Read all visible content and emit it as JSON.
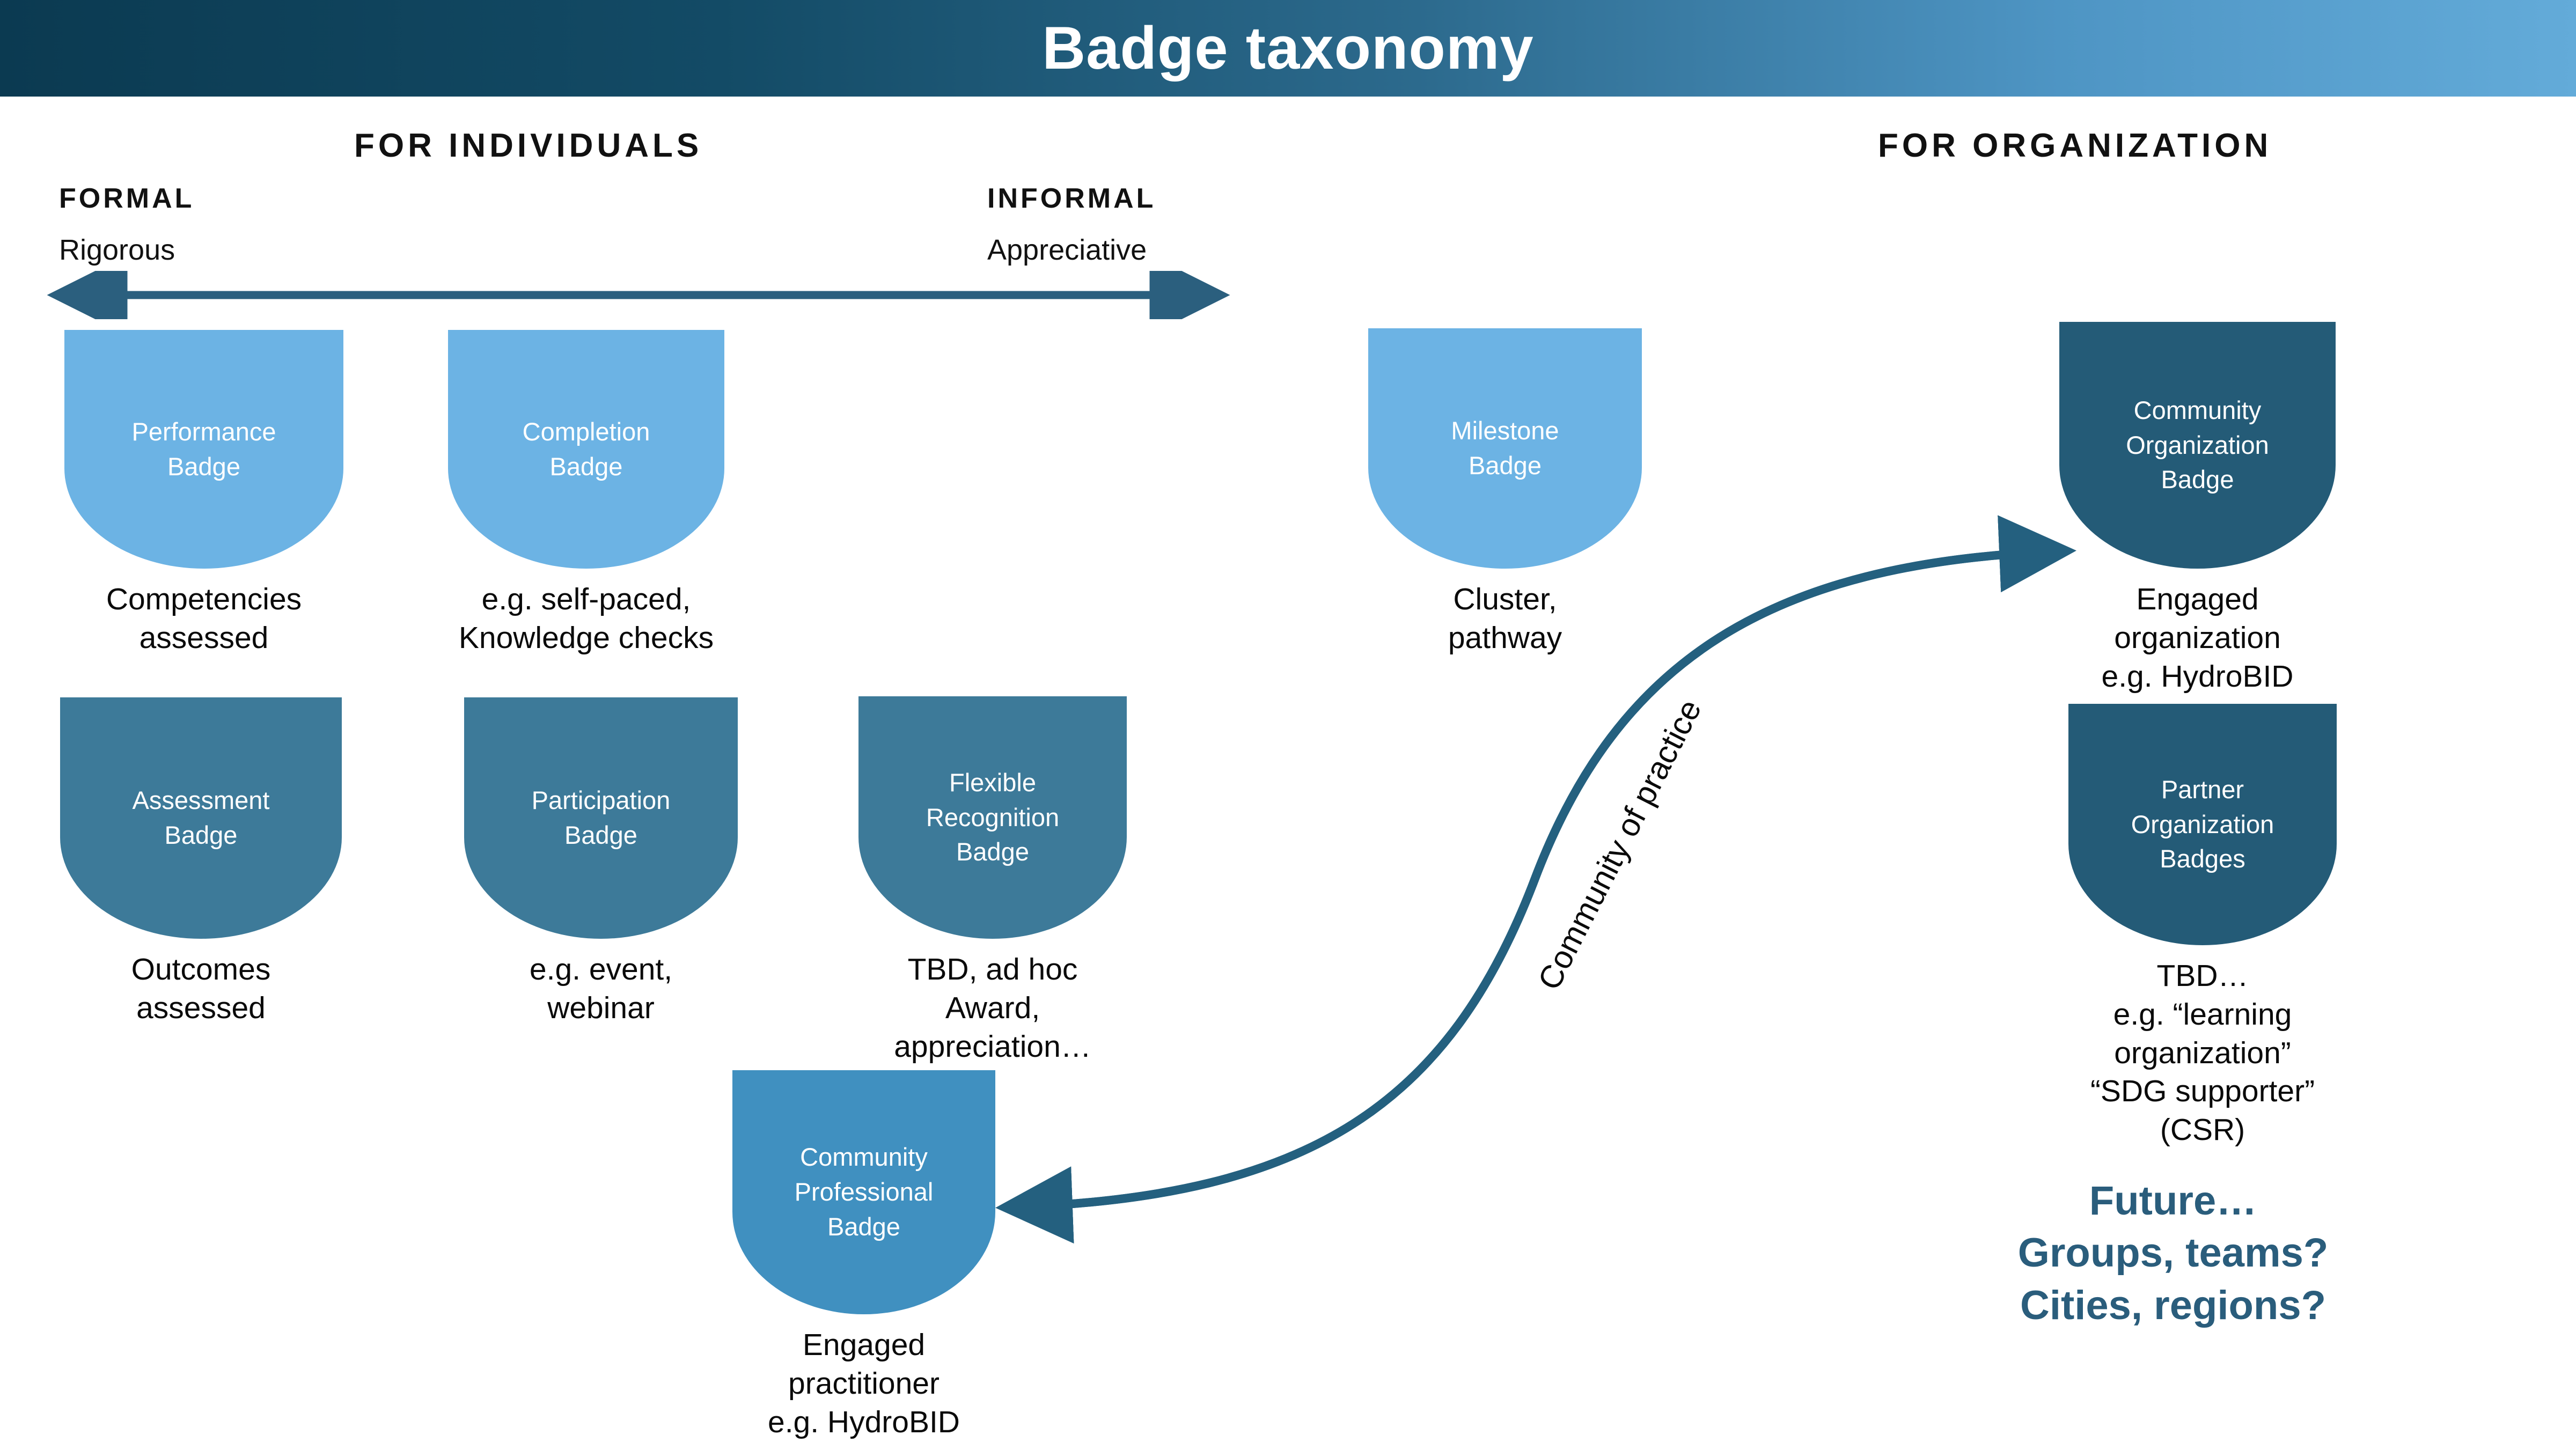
{
  "header": {
    "title": "Badge taxonomy",
    "gradient_from": "#0b3a51",
    "gradient_to": "#63abd9"
  },
  "sections": {
    "individuals": "FOR INDIVIDUALS",
    "organization": "FOR ORGANIZATION"
  },
  "axis": {
    "left_strong": "FORMAL",
    "left_light": "Rigorous",
    "right_strong": "INFORMAL",
    "right_light": "Appreciative",
    "arrow_color": "#2b5f7e",
    "arrow_type": "double-headed-horizontal"
  },
  "colors": {
    "badge_light_blue": "#6cb3e4",
    "badge_mid_blue": "#4090c0",
    "badge_teal": "#3d7a99",
    "badge_navy": "#245b77",
    "accent_text": "#2a5d7c",
    "arrow": "#2b5f7e"
  },
  "badges": [
    {
      "id": "performance",
      "title": "Performance\nBadge",
      "caption": "Competencies\nassessed",
      "fill": "#6cb3e4"
    },
    {
      "id": "completion",
      "title": "Completion\nBadge",
      "caption": "e.g. self-paced,\nKnowledge checks",
      "fill": "#6cb3e4"
    },
    {
      "id": "milestone",
      "title": "Milestone\nBadge",
      "caption": "Cluster,\npathway",
      "fill": "#6cb3e4"
    },
    {
      "id": "community-organization",
      "title": "Community\nOrganization\nBadge",
      "caption": "Engaged organization\ne.g. HydroBID",
      "fill": "#245b77"
    },
    {
      "id": "assessment",
      "title": "Assessment\nBadge",
      "caption": "Outcomes\nassessed",
      "fill": "#3d7a99"
    },
    {
      "id": "participation",
      "title": "Participation\nBadge",
      "caption": "e.g. event,\nwebinar",
      "fill": "#3d7a99"
    },
    {
      "id": "flexible-recognition",
      "title": "Flexible\nRecognition\nBadge",
      "caption": "TBD, ad hoc\nAward, appreciation…",
      "fill": "#3d7a99"
    },
    {
      "id": "partner-organization",
      "title": "Partner\nOrganization\nBadges",
      "caption": "TBD…\ne.g. “learning organization”\n“SDG supporter” (CSR)",
      "fill": "#245b77"
    },
    {
      "id": "community-professional",
      "title": "Community\nProfessional\nBadge",
      "caption": "Engaged practitioner\ne.g. HydroBID",
      "fill": "#4090c0"
    }
  ],
  "community_of_practice": {
    "label": "Community of practice",
    "arrow_type": "double-headed-s-curve",
    "from": "community-professional",
    "to": "community-organization"
  },
  "future": {
    "text": "Future…\nGroups, teams?\nCities, regions?"
  }
}
